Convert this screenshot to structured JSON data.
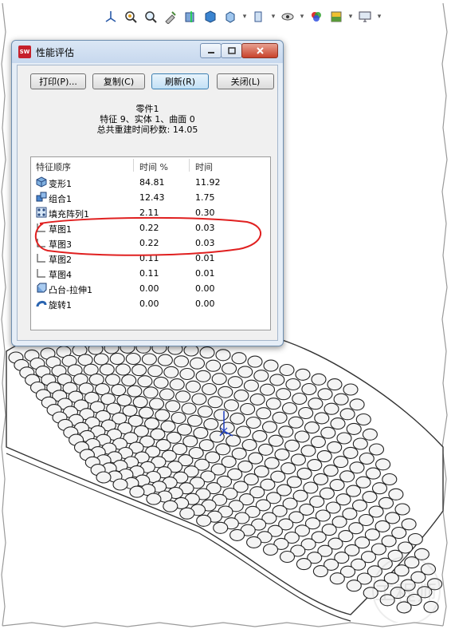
{
  "dialog": {
    "title": "性能评估",
    "app_icon_text": "SW",
    "buttons": {
      "print": "打印(P)...",
      "copy": "复制(C)",
      "refresh": "刷新(R)",
      "close": "关闭(L)"
    },
    "part_name": "零件1",
    "summary": "特征 9、实体 1、曲面 0",
    "rebuild_time": "总共重建时间秒数: 14.05",
    "columns": [
      "特征顺序",
      "时间 %",
      "时间"
    ],
    "rows": [
      {
        "name": "变形1",
        "pct": "84.81",
        "time": "11.92",
        "icon": "deform-icon"
      },
      {
        "name": "组合1",
        "pct": "12.43",
        "time": "1.75",
        "icon": "combine-icon"
      },
      {
        "name": "填充阵列1",
        "pct": "2.11",
        "time": "0.30",
        "icon": "fill-pattern-icon"
      },
      {
        "name": "草图1",
        "pct": "0.22",
        "time": "0.03",
        "icon": "sketch-icon"
      },
      {
        "name": "草图3",
        "pct": "0.22",
        "time": "0.03",
        "icon": "sketch-icon"
      },
      {
        "name": "草图2",
        "pct": "0.11",
        "time": "0.01",
        "icon": "sketch-icon"
      },
      {
        "name": "草图4",
        "pct": "0.11",
        "time": "0.01",
        "icon": "sketch-icon"
      },
      {
        "name": "凸台-拉伸1",
        "pct": "0.00",
        "time": "0.00",
        "icon": "extrude-icon"
      },
      {
        "name": "旋转1",
        "pct": "0.00",
        "time": "0.00",
        "icon": "revolve-icon"
      }
    ]
  },
  "toolbar_icons": [
    "view-orientation-icon",
    "zoom-to-fit-icon",
    "zoom-to-area-icon",
    "previous-view-icon",
    "section-view-icon",
    "view-3d-icon",
    "display-style-icon",
    "hide-show-icon",
    "appearance-icon",
    "scene-icon",
    "display-icon"
  ],
  "watermark_text": "工程师",
  "colors": {
    "annotation_circle": "#e02020",
    "accent": "#3c7fb1",
    "close_button": "#c8422b"
  }
}
